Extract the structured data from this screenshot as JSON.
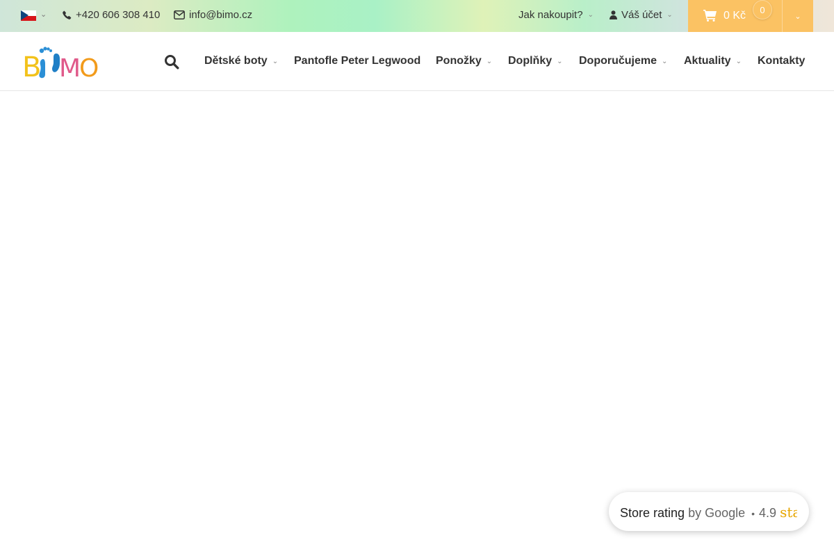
{
  "topbar": {
    "language_flag": "czech-flag",
    "phone": "+420 606 308 410",
    "email": "info@bimo.cz",
    "how_to_buy": "Jak nakoupit?",
    "account": "Váš účet",
    "cart": {
      "price": "0 Kč",
      "count": "0"
    }
  },
  "header": {
    "logo_text": "BIMO",
    "nav": [
      {
        "label": "Dětské boty",
        "has_dropdown": true
      },
      {
        "label": "Pantofle Peter Legwood",
        "has_dropdown": false
      },
      {
        "label": "Ponožky",
        "has_dropdown": true
      },
      {
        "label": "Doplňky",
        "has_dropdown": true
      },
      {
        "label": "Doporučujeme",
        "has_dropdown": true
      },
      {
        "label": "Aktuality",
        "has_dropdown": true
      },
      {
        "label": "Kontakty",
        "has_dropdown": false
      }
    ]
  },
  "rating_widget": {
    "title": "Store rating",
    "by": "by Google",
    "score": "4.9",
    "stars_text": "stars"
  },
  "colors": {
    "accent": "#fbc263",
    "text": "#333333",
    "star": "#e7a600"
  }
}
